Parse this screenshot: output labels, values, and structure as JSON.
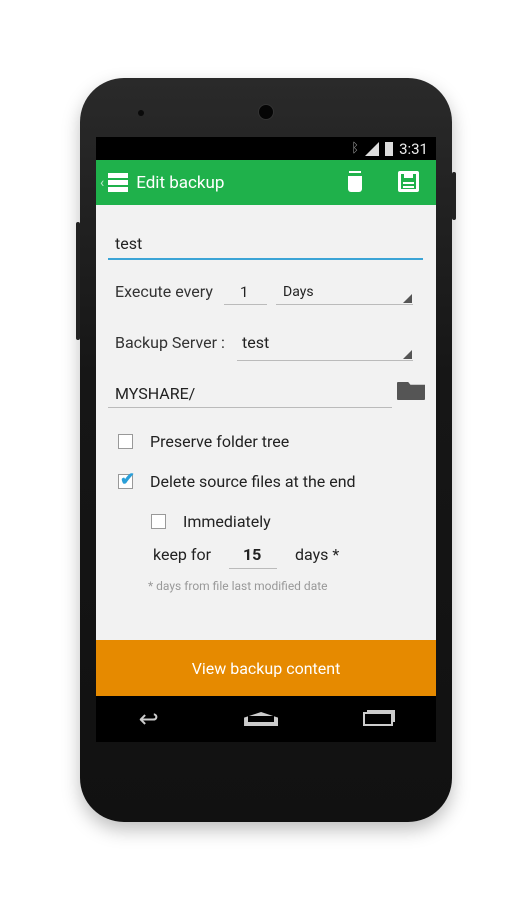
{
  "status_bar": {
    "time": "3:31",
    "icons": [
      "bluetooth-icon",
      "signal-icon",
      "battery-icon"
    ]
  },
  "action_bar": {
    "title": "Edit backup",
    "actions": [
      "delete-icon",
      "save-icon"
    ],
    "color": "#1fb14b"
  },
  "form": {
    "name_value": "test",
    "execute_label": "Execute every",
    "execute_value": "1",
    "execute_unit": "Days",
    "server_label": "Backup Server :",
    "server_value": "test",
    "path_value": "MYSHARE/",
    "preserve_label": "Preserve folder tree",
    "preserve_checked": false,
    "delete_label": "Delete source files at the end",
    "delete_checked": true,
    "immediately_label": "Immediately",
    "immediately_checked": false,
    "keep_label": "keep for",
    "keep_value": "15",
    "keep_unit": "days *",
    "note": "* days from file last modified date"
  },
  "view_button": {
    "label": "View backup content",
    "color": "#e68a00"
  }
}
